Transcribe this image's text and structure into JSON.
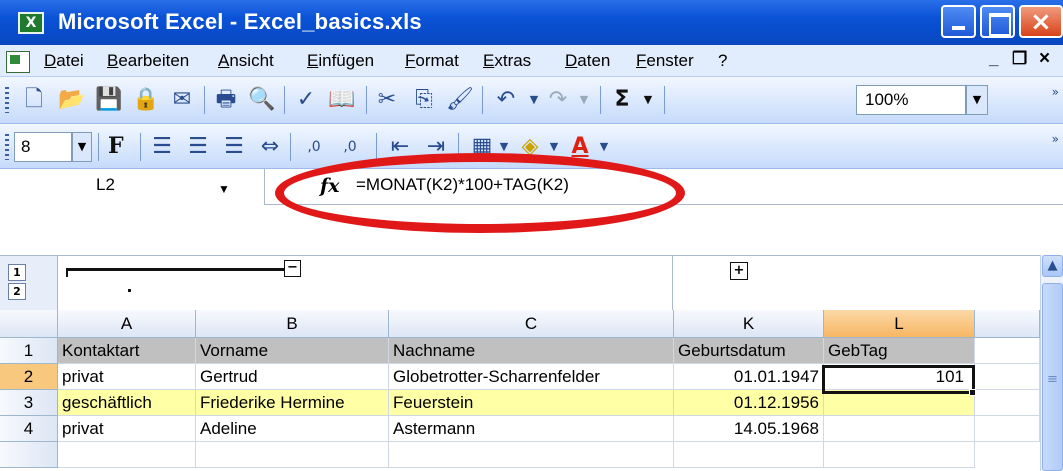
{
  "window": {
    "title": "Microsoft Excel - Excel_basics.xls"
  },
  "menu": [
    "Datei",
    "Bearbeiten",
    "Ansicht",
    "Einfügen",
    "Format",
    "Extras",
    "Daten",
    "Fenster",
    "?"
  ],
  "toolbar": {
    "zoom": "100%",
    "font_size": "8",
    "bold_label": "F"
  },
  "formula_bar": {
    "name_box": "L2",
    "fx": "fx",
    "formula": "=MONAT(K2)*100+TAG(K2)"
  },
  "outline": {
    "levels": [
      "1",
      "2"
    ],
    "collapse": "−",
    "expand": "+"
  },
  "columns": [
    "A",
    "B",
    "C",
    "K",
    "L"
  ],
  "rows": [
    {
      "num": "1",
      "cells": [
        "Kontaktart",
        "Vorname",
        "Nachname",
        "Geburtsdatum",
        "GebTag"
      ]
    },
    {
      "num": "2",
      "cells": [
        "privat",
        "Gertrud",
        "Globetrotter-Scharrenfelder",
        "01.01.1947",
        "101"
      ]
    },
    {
      "num": "3",
      "cells": [
        "geschäftlich",
        "Friederike Hermine",
        "Feuerstein",
        "01.12.1956",
        ""
      ]
    },
    {
      "num": "4",
      "cells": [
        "privat",
        "Adeline",
        "Astermann",
        "14.05.1968",
        ""
      ]
    }
  ],
  "colors": {
    "title_bar": "#0a52d6",
    "highlight_ellipse": "#e01818",
    "header_row": "#c0c0c0",
    "row3_fill": "#ffffa6",
    "active_header": "#f7b764"
  }
}
